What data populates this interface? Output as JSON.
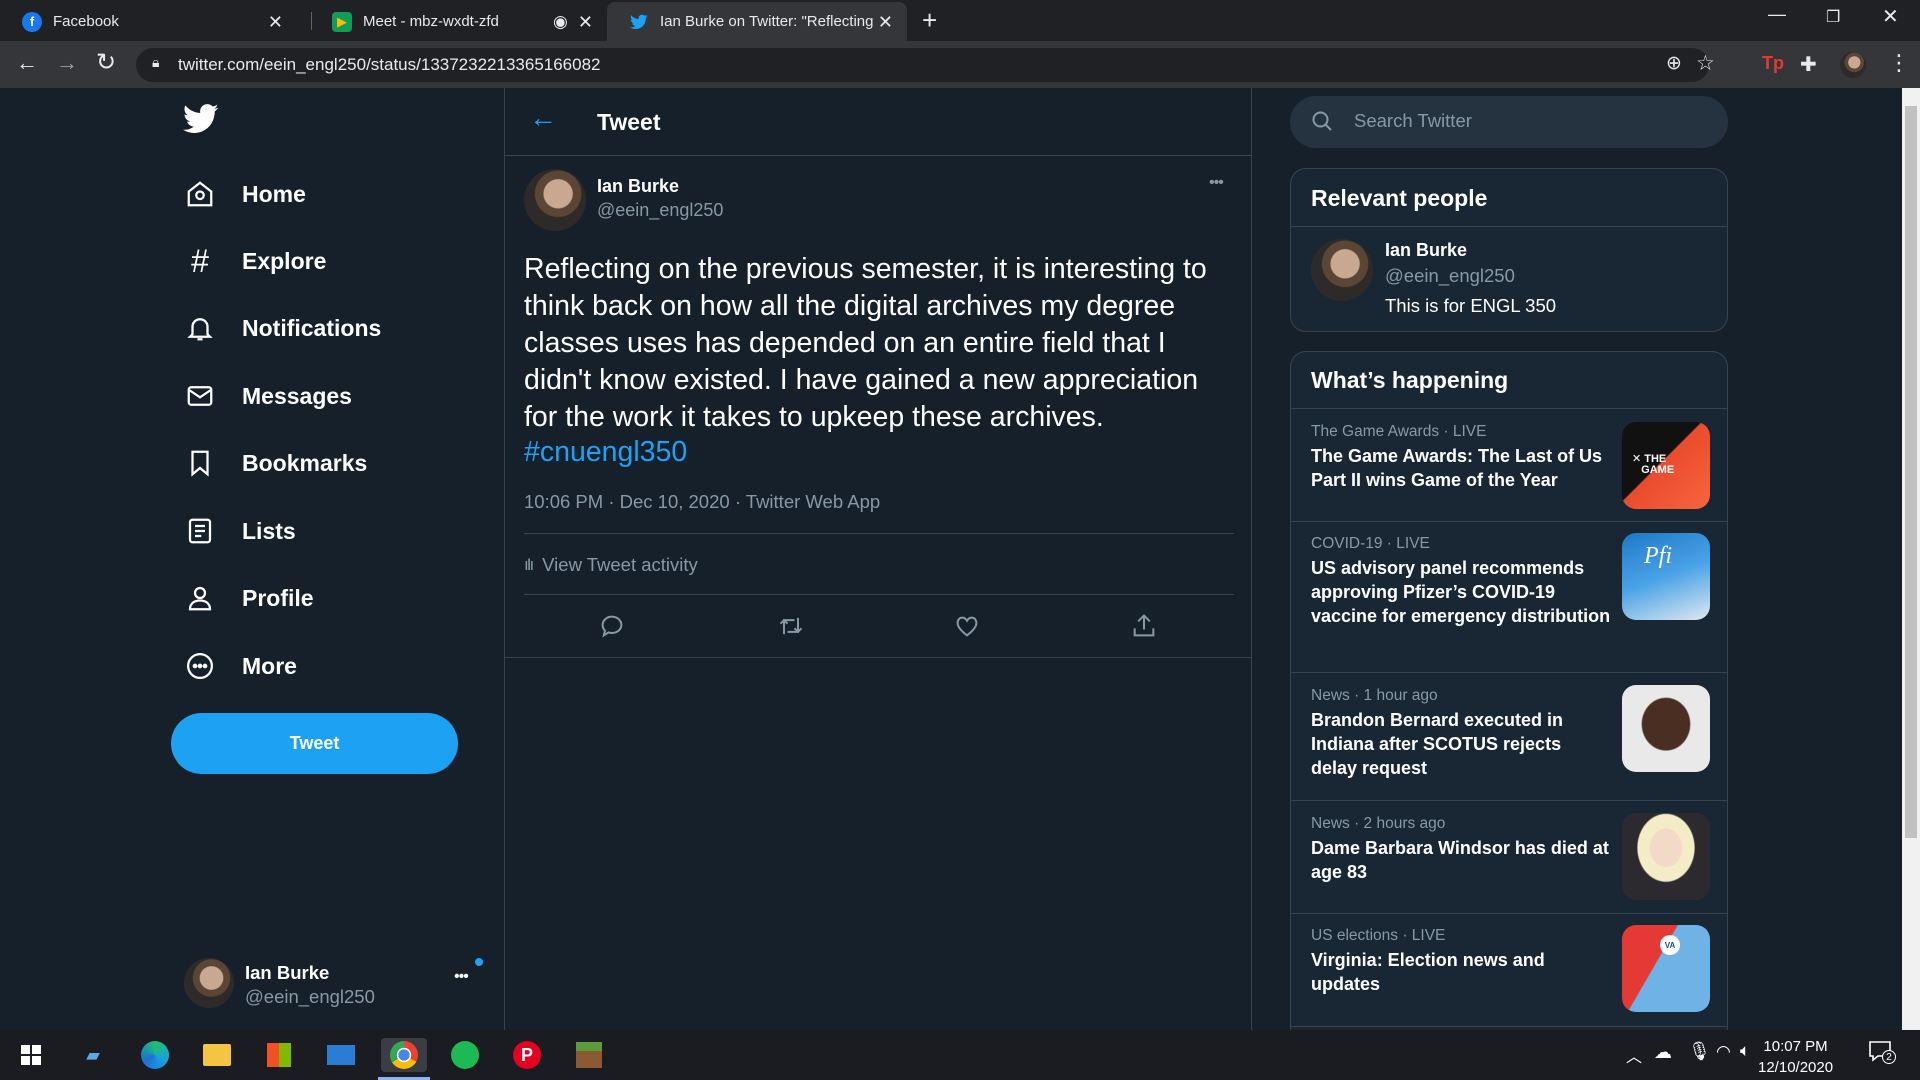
{
  "browser": {
    "tabs": [
      {
        "title": "Facebook",
        "icon": "facebook-icon"
      },
      {
        "title": "Meet - mbz-wxdt-zfd",
        "icon": "meet-icon"
      },
      {
        "title": "Ian Burke on Twitter: \"Reflecting",
        "icon": "twitter-icon"
      }
    ],
    "url": "twitter.com/eein_engl250/status/1337232213365166082"
  },
  "nav": {
    "items": [
      {
        "label": "Home",
        "icon": "home-icon"
      },
      {
        "label": "Explore",
        "icon": "hashtag-icon"
      },
      {
        "label": "Notifications",
        "icon": "bell-icon"
      },
      {
        "label": "Messages",
        "icon": "envelope-icon"
      },
      {
        "label": "Bookmarks",
        "icon": "bookmark-icon"
      },
      {
        "label": "Lists",
        "icon": "list-icon"
      },
      {
        "label": "Profile",
        "icon": "person-icon"
      },
      {
        "label": "More",
        "icon": "more-circle-icon"
      }
    ],
    "tweet_button": "Tweet",
    "account": {
      "name": "Ian Burke",
      "handle": "@eein_engl250"
    }
  },
  "tweet": {
    "header_title": "Tweet",
    "author_name": "Ian Burke",
    "author_handle": "@eein_engl250",
    "text": "Reflecting on the previous semester, it is interesting to think back on how all the digital archives my degree classes uses has depended on an entire field that I didn't know existed. I have gained a new appreciation for the work it takes to upkeep these archives.",
    "hashtag": "#cnuengl350",
    "meta": "10:06 PM · Dec 10, 2020 · Twitter Web App",
    "activity_label": "View Tweet activity"
  },
  "sidebar": {
    "search_placeholder": "Search Twitter",
    "relevant_people": {
      "title": "Relevant people",
      "name": "Ian Burke",
      "handle": "@eein_engl250",
      "bio": "This is for ENGL 350"
    },
    "happening": {
      "title": "What’s happening",
      "trends": [
        {
          "meta": "The Game Awards · LIVE",
          "title": "The Game Awards: The Last of Us Part II wins Game of the Year"
        },
        {
          "meta": "COVID-19 · LIVE",
          "title": "US advisory panel recommends approving Pfizer’s COVID-19 vaccine for emergency distribution"
        },
        {
          "meta": "News · 1 hour ago",
          "title": "Brandon Bernard executed in Indiana after SCOTUS rejects delay request"
        },
        {
          "meta": "News · 2 hours ago",
          "title": "Dame Barbara Windsor has died at age 83"
        },
        {
          "meta": "US elections · LIVE",
          "title": "Virginia: Election news and updates"
        }
      ]
    }
  },
  "taskbar": {
    "time": "10:07 PM",
    "date": "12/10/2020",
    "notification_count": "2"
  },
  "colors": {
    "accent": "#1da1f2",
    "background": "#15202b",
    "card": "#192734",
    "muted": "#8899a6"
  }
}
